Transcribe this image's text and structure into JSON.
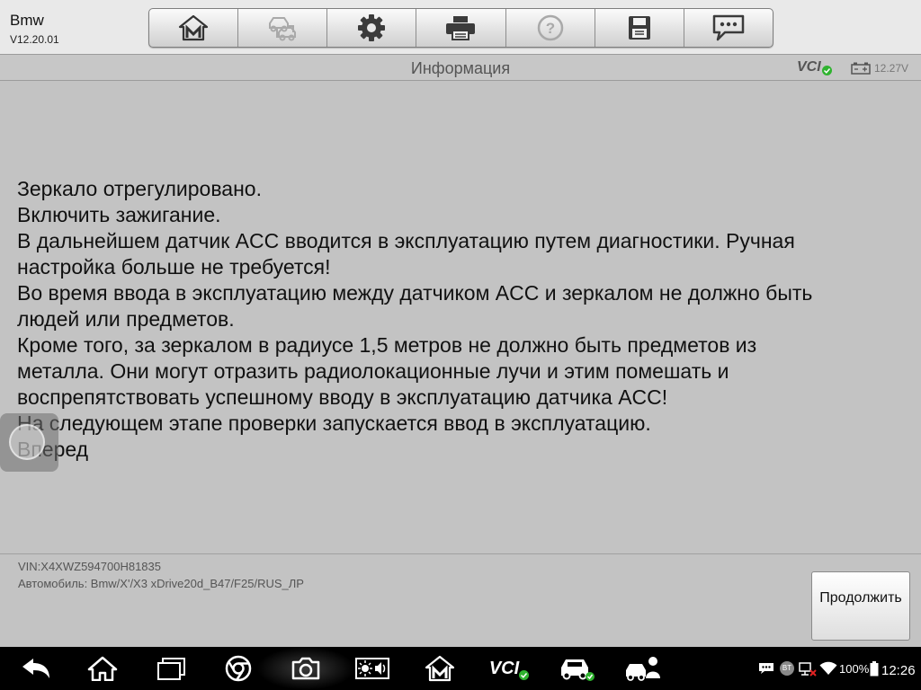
{
  "app": {
    "name": "Bmw",
    "version": "V12.20.01"
  },
  "toolbar": {
    "buttons": [
      "home-m-icon",
      "car-network-icon",
      "gear-icon",
      "printer-icon",
      "help-icon",
      "save-icon",
      "chat-icon"
    ]
  },
  "titlebar": {
    "title": "Информация",
    "vci_label": "VCI",
    "voltage": "12.27V"
  },
  "message": {
    "lines": [
      "Зеркало отрегулировано.",
      "Включить зажигание.",
      "В дальнейшем датчик ACC вводится в эксплуатацию путем диагностики. Ручная",
      "настройка больше не требуется!",
      "Во время ввода в эксплуатацию между датчиком ACC и зеркалом не должно быть",
      "людей или предметов.",
      "Кроме того, за зеркалом в радиусе 1,5 метров не должно быть предметов из",
      "металла. Они могут отразить радиолокационные лучи и этим помешать и",
      "воспрепятствовать успешному вводу в эксплуатацию датчика ACC!",
      "На следующем этапе проверки запускается ввод в эксплуатацию.",
      "Вперед"
    ]
  },
  "footer": {
    "vin": "VIN:X4XWZ594700H81835",
    "vehicle": "Автомобиль: Bmw/X'/X3 xDrive20d_B47/F25/RUS_ЛР",
    "continue_label": "Продолжить"
  },
  "navbar": {
    "icons": [
      "back-icon",
      "home-icon",
      "recent-apps-icon",
      "chrome-icon",
      "camera-icon",
      "brightness-volume-icon",
      "maxisys-icon",
      "vci-icon",
      "car-check-icon",
      "remote-expert-icon"
    ],
    "vci_label": "VCI",
    "battery": "100%",
    "bt_label": "BT",
    "time": "12:26"
  },
  "colors": {
    "check_green": "#2fb32f",
    "error_red": "#e22222"
  }
}
